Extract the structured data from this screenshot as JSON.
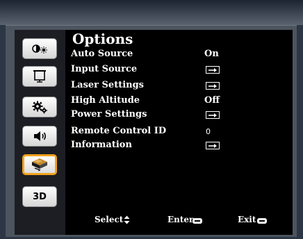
{
  "menu": {
    "title": "Options",
    "items": [
      {
        "label": "Auto Source",
        "value": "On",
        "kind": "text"
      },
      {
        "label": "Input Source",
        "value": "",
        "kind": "arrow"
      },
      {
        "label": "Laser Settings",
        "value": "",
        "kind": "arrow"
      },
      {
        "label": "High Altitude",
        "value": "Off",
        "kind": "text"
      },
      {
        "label": "Power Settings",
        "value": "",
        "kind": "arrow"
      },
      {
        "label": "Remote Control ID",
        "value": "0",
        "kind": "number"
      },
      {
        "label": "Information",
        "value": "",
        "kind": "arrow"
      }
    ]
  },
  "nav": {
    "items": [
      {
        "icon": "picture-contrast-icon"
      },
      {
        "icon": "screen-display-icon"
      },
      {
        "icon": "settings-gears-icon"
      },
      {
        "icon": "speaker-audio-icon"
      },
      {
        "icon": "projector-options-icon",
        "active": true
      },
      {
        "icon": "3d-icon",
        "label": "3D"
      }
    ]
  },
  "footer": {
    "select_label": "Select",
    "enter_label": "Enter",
    "exit_label": "Exit"
  },
  "colors": {
    "active_border": "#f2a31c",
    "panel_background": "#000000",
    "frame": "#4c545f"
  }
}
